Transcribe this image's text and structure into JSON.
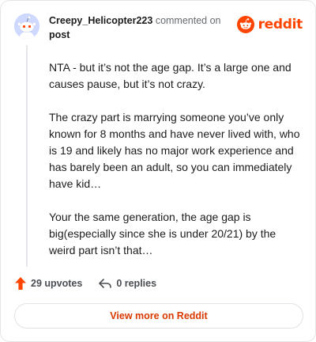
{
  "comment": {
    "username": "Creepy_Helicopter223",
    "action_text": "commented on",
    "target": "post",
    "paragraphs": [
      "NTA - but it’s not the age gap. It’s a large one and causes pause, but it’s not crazy.",
      "The crazy part is marrying someone you’ve only known for 8 months and have never lived with, who is 19 and likely has no major work experience and has barely been an adult, so you can immediately have kid…",
      "Your the same generation, the age gap is big(especially since she is under 20/21) by the weird part isn’t that…"
    ]
  },
  "brand": {
    "name": "reddit",
    "color": "#ff4500",
    "icon": "reddit-logo-icon"
  },
  "actions": {
    "upvotes": "29 upvotes",
    "replies": "0 replies",
    "upvote_icon": "upvote-arrow-icon",
    "reply_icon": "reply-arrow-icon",
    "upvote_color": "#ff4500"
  },
  "footer": {
    "view_more": "View more on Reddit",
    "link_color": "#d93a00"
  }
}
